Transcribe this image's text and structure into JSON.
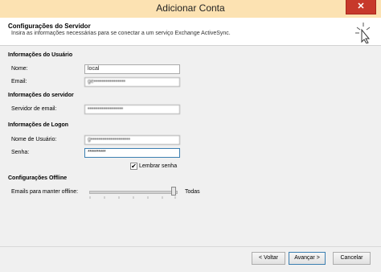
{
  "window": {
    "title": "Adicionar Conta",
    "close_glyph": "✕"
  },
  "header": {
    "title": "Configurações do Servidor",
    "subtitle": "Insira as informações necessárias para se conectar a um serviço Exchange ActiveSync."
  },
  "user_info": {
    "heading": "Informações do Usuário",
    "name_label": "Nome:",
    "name_value": "local",
    "email_label": "Email:",
    "email_value": "ge••••••••••••••••"
  },
  "server_info": {
    "heading": "Informações do servidor",
    "server_label": "Servidor de email:",
    "server_value": "••••••••••••••••••"
  },
  "logon_info": {
    "heading": "Informações de Logon",
    "user_label": "Nome de Usuário:",
    "user_value": "g••••••••••••••••••••",
    "password_label": "Senha:",
    "password_value": "**********",
    "remember_label": "Lembrar senha",
    "remember_checked": "✔"
  },
  "offline": {
    "heading": "Configurações Offline",
    "emails_label": "Emails para manter offline:",
    "slider_value_label": "Todas",
    "slider_level": 1.0
  },
  "buttons": {
    "back": "< Voltar",
    "next": "Avançar >",
    "cancel": "Cancelar"
  }
}
